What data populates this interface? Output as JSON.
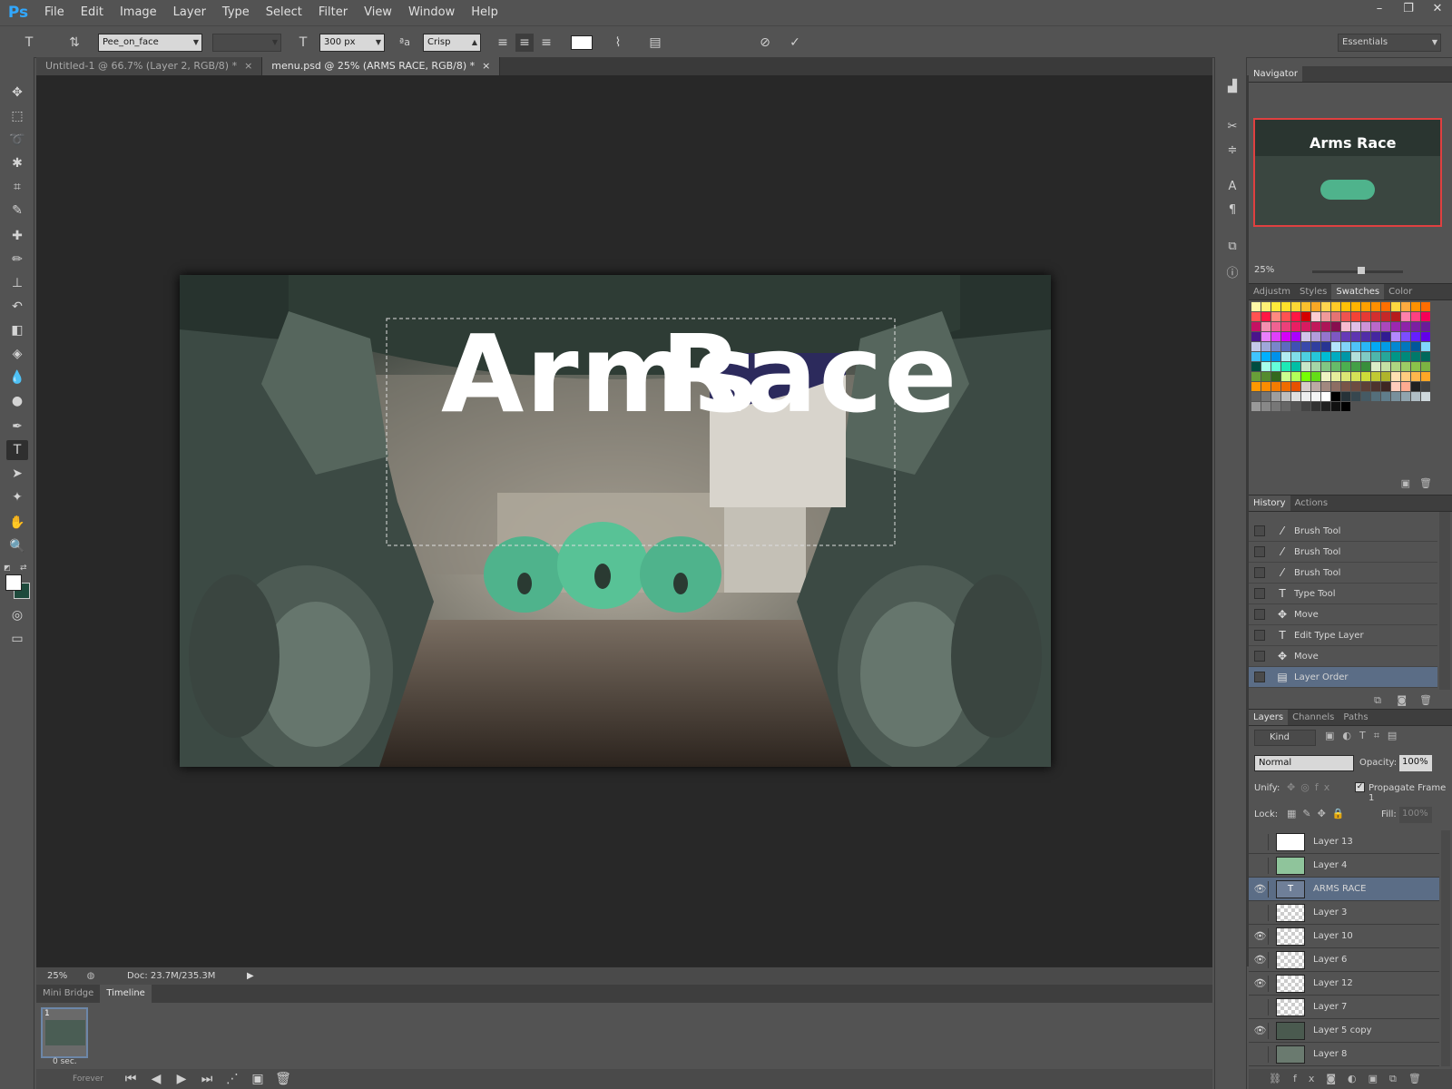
{
  "app": {
    "logo": "Ps"
  },
  "menu": [
    "File",
    "Edit",
    "Image",
    "Layer",
    "Type",
    "Select",
    "Filter",
    "View",
    "Window",
    "Help"
  ],
  "window_controls": [
    "–",
    "❐",
    "✕"
  ],
  "options": {
    "font_family": "Pee_on_face",
    "font_style": "",
    "font_size": "300 px",
    "antialias": "Crisp",
    "workspace": "Essentials"
  },
  "tabs": [
    {
      "label": "Untitled-1 @ 66.7% (Layer 2, RGB/8) *"
    },
    {
      "label": "menu.psd @ 25% (ARMS RACE, RGB/8) *"
    }
  ],
  "tab_close": "×",
  "document": {
    "title_a": "Arms",
    "title_b": "Race"
  },
  "status": {
    "zoom": "25%",
    "doc": "Doc: 23.7M/235.3M"
  },
  "timeline": {
    "tabs": [
      "Mini Bridge",
      "Timeline"
    ],
    "frame_number": "1",
    "frame_delay": "0 sec.",
    "loop": "Forever"
  },
  "navigator": {
    "title": "Navigator",
    "zoom": "25%",
    "preview_title": "Arms Race"
  },
  "swatch_tabs": [
    "Adjustm",
    "Styles",
    "Swatches",
    "Color"
  ],
  "swatch_colors": [
    "#fff9a8",
    "#fff176",
    "#ffeb3b",
    "#ffe12b",
    "#fdd835",
    "#fbc02d",
    "#f9a825",
    "#ffd54f",
    "#ffca28",
    "#ffc107",
    "#ffb300",
    "#ffa000",
    "#ff8f00",
    "#ff6f00",
    "#ffd740",
    "#ffab40",
    "#ff9100",
    "#ff6d00",
    "#ff5252",
    "#ff1744",
    "#ff8a80",
    "#ff5252",
    "#ff1744",
    "#d50000",
    "#ffcdd2",
    "#ef9a9a",
    "#e57373",
    "#ef5350",
    "#f44336",
    "#e53935",
    "#d32f2f",
    "#c62828",
    "#b71c1c",
    "#ff80ab",
    "#ff4081",
    "#f50057",
    "#c51162",
    "#f48fb1",
    "#f06292",
    "#ec407a",
    "#e91e63",
    "#d81b60",
    "#c2185b",
    "#ad1457",
    "#880e4f",
    "#f8bbd0",
    "#e1bee7",
    "#ce93d8",
    "#ba68c8",
    "#ab47bc",
    "#9c27b0",
    "#8e24aa",
    "#7b1fa2",
    "#6a1b9a",
    "#4a148c",
    "#ea80fc",
    "#e040fb",
    "#d500f9",
    "#aa00ff",
    "#d1c4e9",
    "#b39ddb",
    "#9575cd",
    "#7e57c2",
    "#673ab7",
    "#5e35b1",
    "#512da8",
    "#4527a0",
    "#311b92",
    "#b388ff",
    "#7c4dff",
    "#651fff",
    "#6200ea",
    "#c5cae9",
    "#9fa8da",
    "#7986cb",
    "#5c6bc0",
    "#3f51b5",
    "#3949ab",
    "#303f9f",
    "#283593",
    "#b3e5fc",
    "#81d4fa",
    "#4fc3f7",
    "#29b6f6",
    "#03a9f4",
    "#039be5",
    "#0288d1",
    "#0277bd",
    "#01579b",
    "#80d8ff",
    "#40c4ff",
    "#00b0ff",
    "#0091ea",
    "#b2ebf2",
    "#80deea",
    "#4dd0e1",
    "#26c6da",
    "#00bcd4",
    "#00acc1",
    "#0097a7",
    "#b2dfdb",
    "#80cbc4",
    "#4db6ac",
    "#26a69a",
    "#009688",
    "#00897b",
    "#00796b",
    "#00695c",
    "#004d40",
    "#a7ffeb",
    "#64ffda",
    "#1de9b6",
    "#00bfa5",
    "#c8e6c9",
    "#a5d6a7",
    "#81c784",
    "#66bb6a",
    "#4caf50",
    "#43a047",
    "#388e3c",
    "#dcedc8",
    "#c5e1a5",
    "#aed581",
    "#9ccc65",
    "#8bc34a",
    "#7cb342",
    "#689f38",
    "#558b2f",
    "#33691e",
    "#ccff90",
    "#b2ff59",
    "#76ff03",
    "#64dd17",
    "#f0f4c3",
    "#e6ee9c",
    "#dce775",
    "#d4e157",
    "#cddc39",
    "#c0ca33",
    "#afb42b",
    "#ffe0b2",
    "#ffcc80",
    "#ffb74d",
    "#ffa726",
    "#ff9800",
    "#fb8c00",
    "#f57c00",
    "#ef6c00",
    "#e65100",
    "#d7ccc8",
    "#bcaaa4",
    "#a1887f",
    "#8d6e63",
    "#795548",
    "#6d4c41",
    "#5d4037",
    "#4e342e",
    "#3e2723",
    "#ffccbc",
    "#ffab91",
    "#212121",
    "#424242",
    "#616161",
    "#757575",
    "#9e9e9e",
    "#bdbdbd",
    "#e0e0e0",
    "#eeeeee",
    "#f5f5f5",
    "#ffffff",
    "#000000",
    "#263238",
    "#37474f",
    "#455a64",
    "#546e7a",
    "#607d8b",
    "#78909c",
    "#90a4ae",
    "#b0bec5",
    "#cfd8dc",
    "#999999",
    "#888888",
    "#777777",
    "#666666",
    "#555555",
    "#444444",
    "#333333",
    "#222222",
    "#111111",
    "#000000"
  ],
  "history": {
    "tabs": [
      "History",
      "Actions"
    ],
    "items": [
      {
        "icon": "brush",
        "label": "Brush Tool"
      },
      {
        "icon": "brush",
        "label": "Brush Tool"
      },
      {
        "icon": "brush",
        "label": "Brush Tool"
      },
      {
        "icon": "type",
        "label": "Type Tool"
      },
      {
        "icon": "move",
        "label": "Move"
      },
      {
        "icon": "type",
        "label": "Edit Type Layer"
      },
      {
        "icon": "move",
        "label": "Move"
      },
      {
        "icon": "layer",
        "label": "Layer Order"
      }
    ]
  },
  "layers": {
    "tabs": [
      "Layers",
      "Channels",
      "Paths"
    ],
    "filter": "Kind",
    "blend_mode": "Normal",
    "opacity_label": "Opacity:",
    "opacity": "100%",
    "unify_label": "Unify:",
    "propagate": "Propagate Frame 1",
    "lock_label": "Lock:",
    "fill_label": "Fill:",
    "fill": "100%",
    "items": [
      {
        "name": "Layer 13",
        "visible": false,
        "thumb": "#ffffff"
      },
      {
        "name": "Layer 4",
        "visible": false,
        "thumb": "#8fc49b"
      },
      {
        "name": "ARMS RACE",
        "visible": true,
        "thumb": "type",
        "selected": true
      },
      {
        "name": "Layer 3",
        "visible": false,
        "thumb": "checker"
      },
      {
        "name": "Layer 10",
        "visible": true,
        "thumb": "checker"
      },
      {
        "name": "Layer 6",
        "visible": true,
        "thumb": "checker"
      },
      {
        "name": "Layer 12",
        "visible": true,
        "thumb": "checker"
      },
      {
        "name": "Layer 7",
        "visible": false,
        "thumb": "checker"
      },
      {
        "name": "Layer 5 copy",
        "visible": true,
        "thumb": "#4a5a4f"
      },
      {
        "name": "Layer 8",
        "visible": false,
        "thumb": "#6a7a6f"
      }
    ]
  }
}
